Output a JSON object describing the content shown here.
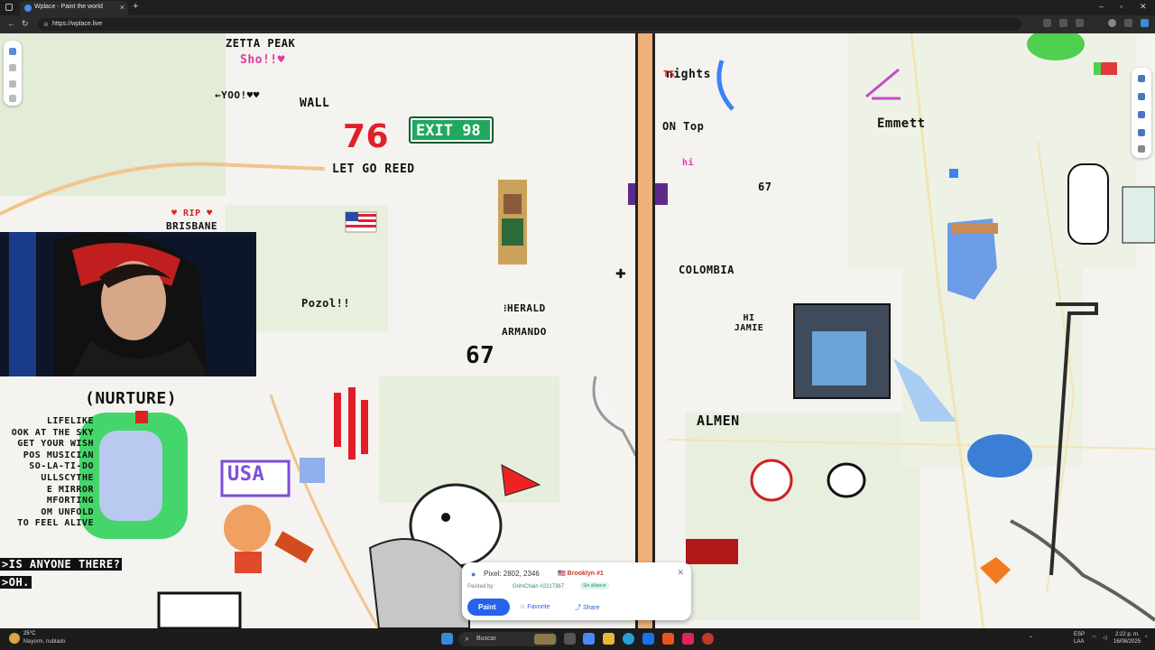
{
  "browser": {
    "tab_title": "Wplace - Paint the world",
    "url": "https://wplace.live"
  },
  "canvas_text": {
    "zetta": "ZETTA PEAK",
    "sho": "Sho!!♥",
    "yoo": "←YOO!♥♥",
    "wall": "WALL",
    "n76": "76",
    "exit": "EXIT 98",
    "letgo": "LET GO REED",
    "rip": "♥ RIP ♥",
    "brisbane": "BRISBANE",
    "pozol": "Pozol!!",
    "herald": "⁝HERALD",
    "armando": "ARMANDO",
    "n67a": "67",
    "n67b": "67",
    "nurture": "(NURTURE)",
    "lifelike": [
      "LIFELIKE",
      "OOK AT THE SKY",
      "GET YOUR WISH",
      "POS MUSICIAN",
      "SO-LA-TI-DO",
      "ULLSCYTHE",
      "E MIRROR",
      "MFORTING",
      "OM UNFOLD",
      "TO FEEL ALIVE"
    ],
    "usa": "USA",
    "anyone": ">IS ANYONE THERE?",
    "oh": ">OH.",
    "nights": "nights",
    "on_top": "ON Top",
    "hi": "hi",
    "colombia": "COLOMBIA",
    "hi_jamie": "HI JAMIE",
    "emmett": "Emmett",
    "almen": "ALMEN",
    "ts": "TS"
  },
  "pixel_panel": {
    "coords": "Pixel: 2802, 2346",
    "region": "🇺🇸 Brooklyn #1",
    "painted_by": "Painted by:",
    "user": "GrimChain #2217367",
    "badge": "Sin alliance",
    "paint": "Paint",
    "favorite": "Favorite",
    "share": "Share"
  },
  "taskbar": {
    "temp": "25°C",
    "weather": "Mayorm. nublado",
    "search": "Buscar",
    "lang": "ESP",
    "lang2": "LAA",
    "time": "2:22 p. m.",
    "date": "16/08/2025"
  },
  "colors": {
    "map_bg": "#f4f3ef",
    "park": "#d8e8c8",
    "road": "#f2c48e",
    "water": "#a9cdf2",
    "accent": "#2563eb"
  }
}
